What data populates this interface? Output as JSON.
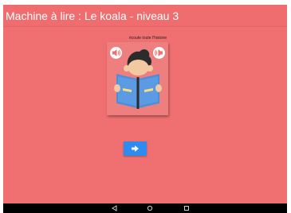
{
  "app": {
    "title": "Machine à lire : Le koala - niveau 3"
  },
  "main": {
    "hint_text": "écoute toute l'histoire",
    "illustration": "child-reading-book",
    "left_sound_icon": "speaker-icon",
    "right_sound_icon": "speaker-icon",
    "next_icon": "arrow-right-icon"
  },
  "system_nav": {
    "back_icon": "back-triangle-icon",
    "home_icon": "home-circle-icon",
    "recents_icon": "recents-square-icon"
  },
  "colors": {
    "background": "#f07071",
    "card": "#ef7e7f",
    "button": "#2e8cf0",
    "book": "#4e8ed8"
  }
}
